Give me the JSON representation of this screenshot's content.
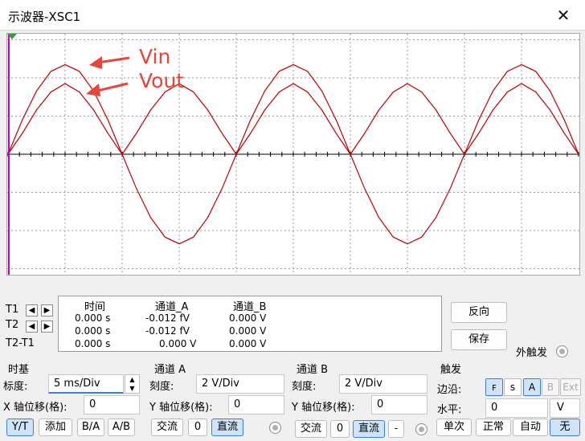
{
  "window": {
    "title": "示波器-XSC1",
    "close_glyph": "✕"
  },
  "annotations": {
    "vin": "Vin",
    "vout": "Vout",
    "color": "#e8443a"
  },
  "chart_data": {
    "type": "line",
    "grid": true,
    "divisions_x": 10,
    "divisions_y": 6,
    "series": [
      {
        "name": "Vin",
        "color": "#c00000",
        "shape": "full-wave sine",
        "amplitude_div": 2.35,
        "period_div": 4,
        "x_div": [
          0,
          0.25,
          0.5,
          0.75,
          1,
          1.25,
          1.5,
          1.75,
          2,
          2.25,
          2.5,
          2.75,
          3,
          3.25,
          3.5,
          3.75,
          4,
          4.25,
          4.5,
          4.75,
          5,
          5.25,
          5.5,
          5.75,
          6,
          6.25,
          6.5,
          6.75,
          7,
          7.25,
          7.5,
          7.75,
          8,
          8.25,
          8.5,
          8.75,
          9,
          9.25,
          9.5,
          9.75,
          10
        ],
        "y_div": [
          0,
          0.9,
          1.66,
          2.17,
          2.35,
          2.17,
          1.66,
          0.9,
          0,
          -0.9,
          -1.66,
          -2.17,
          -2.35,
          -2.17,
          -1.66,
          -0.9,
          0,
          0.9,
          1.66,
          2.17,
          2.35,
          2.17,
          1.66,
          0.9,
          0,
          -0.9,
          -1.66,
          -2.17,
          -2.35,
          -2.17,
          -1.66,
          -0.9,
          0,
          0.9,
          1.66,
          2.17,
          2.35,
          2.17,
          1.66,
          0.9,
          0
        ]
      },
      {
        "name": "Vout",
        "color": "#c00000",
        "shape": "full-wave rectified",
        "amplitude_div": 1.85,
        "period_div": 2,
        "x_div": [
          0,
          0.25,
          0.5,
          0.75,
          1,
          1.25,
          1.5,
          1.75,
          2,
          2.25,
          2.5,
          2.75,
          3,
          3.25,
          3.5,
          3.75,
          4,
          4.25,
          4.5,
          4.75,
          5,
          5.25,
          5.5,
          5.75,
          6,
          6.25,
          6.5,
          6.75,
          7,
          7.25,
          7.5,
          7.75,
          8,
          8.25,
          8.5,
          8.75,
          9,
          9.25,
          9.5,
          9.75,
          10
        ],
        "y_div": [
          0,
          0.55,
          1.16,
          1.63,
          1.85,
          1.63,
          1.16,
          0.55,
          0,
          0.55,
          1.16,
          1.63,
          1.85,
          1.63,
          1.16,
          0.55,
          0,
          0.55,
          1.16,
          1.63,
          1.85,
          1.63,
          1.16,
          0.55,
          0,
          0.55,
          1.16,
          1.63,
          1.85,
          1.63,
          1.16,
          0.55,
          0,
          0.55,
          1.16,
          1.63,
          1.85,
          1.63,
          1.16,
          0.55,
          0
        ]
      }
    ]
  },
  "cursor_rows": {
    "t1": "T1",
    "t2": "T2",
    "t2t1": "T2-T1"
  },
  "measurements": {
    "headers": [
      "时间",
      "通道_A",
      "通道_B"
    ],
    "rows": [
      [
        "0.000 s",
        "-0.012 fV",
        "0.000 V"
      ],
      [
        "0.000 s",
        "-0.012 fV",
        "0.000 V"
      ],
      [
        "0.000 s",
        "0.000 V",
        "0.000 V"
      ]
    ]
  },
  "buttons": {
    "reverse": "反向",
    "save": "保存",
    "external_trigger": "外触发"
  },
  "timebase": {
    "section": "时基",
    "scale_label": "标度:",
    "scale_value": "5 ms/Div",
    "xpos_label": "X 轴位移(格):",
    "xpos_value": "0",
    "modes": [
      "Y/T",
      "添加",
      "B/A",
      "A/B"
    ]
  },
  "channel_a": {
    "section": "通道 A",
    "scale_label": "刻度:",
    "scale_value": "2  V/Div",
    "ypos_label": "Y 轴位移(格):",
    "ypos_value": "0",
    "coupling": [
      "交流",
      "0",
      "直流"
    ]
  },
  "channel_b": {
    "section": "通道 B",
    "scale_label": "刻度:",
    "scale_value": "2  V/Div",
    "ypos_label": "Y 轴位移(格):",
    "ypos_value": "0",
    "coupling": [
      "交流",
      "0",
      "直流",
      "-"
    ]
  },
  "trigger": {
    "section": "触发",
    "edge_label": "边沿:",
    "edge_rising_glyph": "ꜰ",
    "edge_falling_glyph": "ꜱ",
    "sources": [
      "A",
      "B",
      "Ext"
    ],
    "level_label": "水平:",
    "level_value": "0",
    "level_unit": "V",
    "modes": [
      "单次",
      "正常",
      "自动",
      "无"
    ]
  }
}
